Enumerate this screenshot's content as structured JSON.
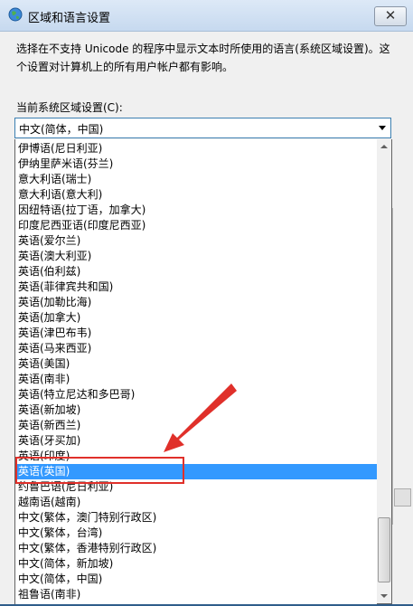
{
  "window": {
    "title": "区域和语言设置",
    "close_symbol": "✕"
  },
  "description": "选择在不支持 Unicode 的程序中显示文本时所使用的语言(系统区域设置)。这个设置对计算机上的所有用户帐户都有影响。",
  "current_locale": {
    "label": "当前系统区域设置(C):",
    "value": "中文(简体，中国)"
  },
  "dropdown": {
    "selected_index": 21,
    "items": [
      "伊博语(尼日利亚)",
      "伊纳里萨米语(芬兰)",
      "意大利语(瑞士)",
      "意大利语(意大利)",
      "因纽特语(拉丁语，加拿大)",
      "印度尼西亚语(印度尼西亚)",
      "英语(爱尔兰)",
      "英语(澳大利亚)",
      "英语(伯利兹)",
      "英语(菲律宾共和国)",
      "英语(加勒比海)",
      "英语(加拿大)",
      "英语(津巴布韦)",
      "英语(马来西亚)",
      "英语(美国)",
      "英语(南非)",
      "英语(特立尼达和多巴哥)",
      "英语(新加坡)",
      "英语(新西兰)",
      "英语(牙买加)",
      "英语(印度)",
      "英语(英国)",
      "约鲁巴语(尼日利亚)",
      "越南语(越南)",
      "中文(繁体，澳门特别行政区)",
      "中文(繁体，台湾)",
      "中文(繁体，香港特别行政区)",
      "中文(简体，新加坡)",
      "中文(简体，中国)",
      "祖鲁语(南非)"
    ]
  },
  "colors": {
    "selection": "#3399ff",
    "annotation": "#e0302a"
  }
}
